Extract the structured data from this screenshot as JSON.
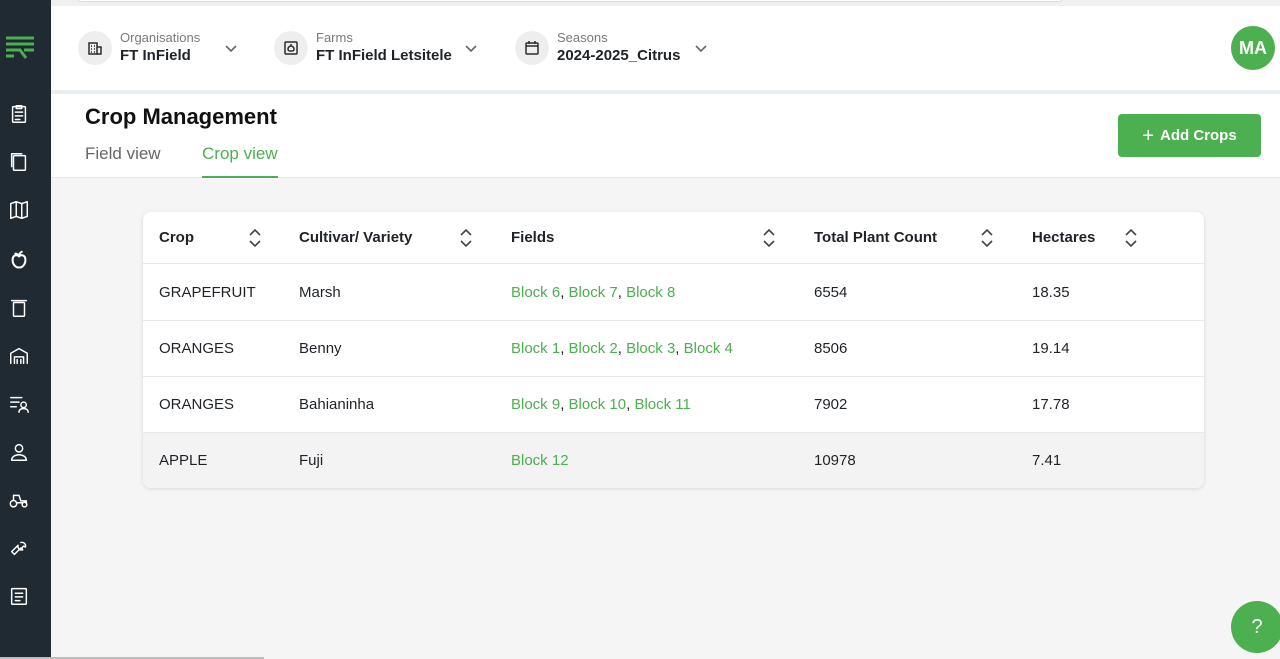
{
  "header": {
    "organisation": {
      "label": "Organisations",
      "value": "FT InField"
    },
    "farm": {
      "label": "Farms",
      "value": "FT InField Letsitele"
    },
    "season": {
      "label": "Seasons",
      "value": "2024-2025_Citrus"
    },
    "avatar_initials": "MA"
  },
  "page": {
    "title": "Crop Management",
    "tabs": [
      {
        "label": "Field view",
        "active": false
      },
      {
        "label": "Crop view",
        "active": true
      }
    ],
    "add_button_label": "Add Crops",
    "add_button_icon": "plus-icon"
  },
  "table": {
    "columns": [
      "Crop",
      "Cultivar/ Variety",
      "Fields",
      "Total Plant Count",
      "Hectares"
    ],
    "rows": [
      {
        "crop": "GRAPEFRUIT",
        "variety": "Marsh",
        "fields": [
          "Block 6",
          "Block 7",
          "Block 8"
        ],
        "plant_count": "6554",
        "hectares": "18.35"
      },
      {
        "crop": "ORANGES",
        "variety": "Benny",
        "fields": [
          "Block 1",
          "Block 2",
          "Block 3",
          "Block 4"
        ],
        "plant_count": "8506",
        "hectares": "19.14"
      },
      {
        "crop": "ORANGES",
        "variety": "Bahianinha",
        "fields": [
          "Block 9",
          "Block 10",
          "Block 11"
        ],
        "plant_count": "7902",
        "hectares": "17.78"
      },
      {
        "crop": "APPLE",
        "variety": "Fuji",
        "fields": [
          "Block 12"
        ],
        "plant_count": "10978",
        "hectares": "7.41"
      }
    ]
  },
  "help_label": "?",
  "colors": {
    "accent": "#4caf50",
    "sidebar": "#1f2a33"
  },
  "sidebar_icons": [
    "clipboard-icon",
    "document-icon",
    "map-icon",
    "apple-icon",
    "bin-icon",
    "warehouse-icon",
    "filter-user-icon",
    "person-icon",
    "tractor-icon",
    "wrench-icon",
    "report-icon"
  ]
}
